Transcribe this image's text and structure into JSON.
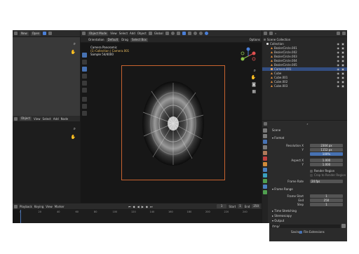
{
  "topbar": {
    "new_label": "New",
    "open_label": "Open",
    "mode_label": "Object Mode",
    "menus": [
      "View",
      "Select",
      "Add",
      "Object"
    ],
    "transform_label": "Global",
    "options_label": "Options"
  },
  "vp_header": {
    "items": [
      "Orientation",
      "Default",
      "Drag",
      "Select Box"
    ]
  },
  "viewport": {
    "line1": "Camera Panoramic",
    "line2": "(1) Collection | Camera.001",
    "line3": "Sample 54/4000"
  },
  "left_header": {
    "mode_label": "Object",
    "menus": [
      "View",
      "Select",
      "Add",
      "Node"
    ]
  },
  "outliner": {
    "title": "Scene Collection",
    "items": [
      {
        "name": "Collection",
        "selected": false
      },
      {
        "name": "BezierCircle.001",
        "selected": false
      },
      {
        "name": "BezierCircle.002",
        "selected": false
      },
      {
        "name": "BezierCircle.003",
        "selected": false
      },
      {
        "name": "BezierCircle.004",
        "selected": false
      },
      {
        "name": "BezierCircle.005",
        "selected": false
      },
      {
        "name": "Camera.001",
        "selected": true
      },
      {
        "name": "Cube",
        "selected": false
      },
      {
        "name": "Cube.001",
        "selected": false
      },
      {
        "name": "Cube.002",
        "selected": false
      },
      {
        "name": "Cube.003",
        "selected": false
      }
    ]
  },
  "properties": {
    "scene_label": "Scene",
    "format_label": "Format",
    "resolution_x_label": "Resolution X",
    "resolution_x": "2304 px",
    "resolution_y_label": "Y",
    "resolution_y": "1152 px",
    "percent": "100%",
    "aspect_x_label": "Aspect X",
    "aspect_x": "1.000",
    "aspect_y_label": "Y",
    "aspect_y": "1.000",
    "render_region_label": "Render Region",
    "crop_label": "Crop to Render Region",
    "frame_rate_label": "Frame Rate",
    "frame_rate": "24 fps",
    "frame_range_label": "Frame Range",
    "frame_start_label": "Frame Start",
    "frame_start": "1",
    "end_label": "End",
    "end": "250",
    "step_label": "Step",
    "step": "1",
    "time_stretching_label": "Time Stretching",
    "stereoscopy_label": "Stereoscopy",
    "output_label": "Output",
    "output_path": "/tmp/",
    "saving_label": "Saving",
    "file_ext_label": "File Extensions"
  },
  "timeline": {
    "menus": [
      "Playback",
      "Keying",
      "View",
      "Marker"
    ],
    "current_frame": "1",
    "start_label": "Start",
    "start": "1",
    "end_label": "End",
    "end": "250",
    "ticks": [
      "0",
      "20",
      "40",
      "60",
      "80",
      "100",
      "120",
      "140",
      "160",
      "180",
      "200",
      "220",
      "240"
    ]
  }
}
